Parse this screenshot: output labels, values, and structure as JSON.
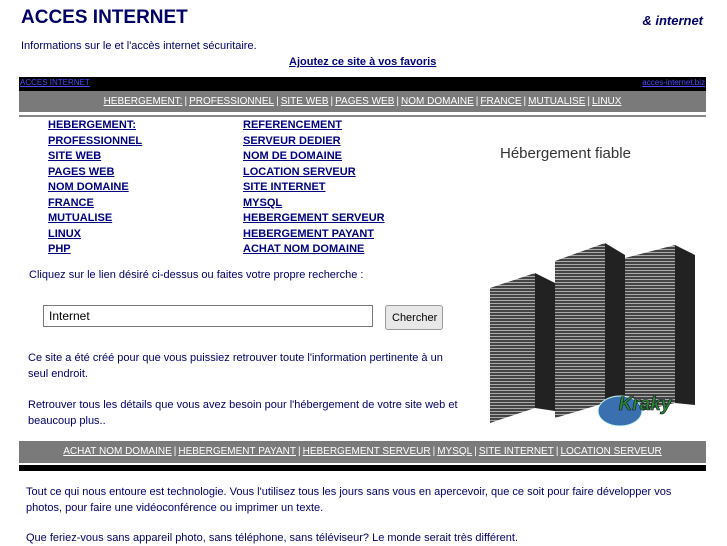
{
  "header": {
    "title": "ACCES INTERNET",
    "tagline": "& internet",
    "intro": "Informations sur le et l'accès internet sécuritaire.",
    "favorites_link": "Ajoutez ce site à vos favoris"
  },
  "blackbar": {
    "left_link": "ACCES INTERNET",
    "right_link": "acces-internet.biz"
  },
  "top_nav": [
    "HEBERGEMENT:",
    "PROFESSIONNEL",
    "SITE WEB",
    "PAGES WEB",
    "NOM DOMAINE",
    "FRANCE",
    "MUTUALISE",
    "LINUX"
  ],
  "links_col1": [
    "HEBERGEMENT:",
    "PROFESSIONNEL",
    "SITE WEB",
    "PAGES WEB",
    "NOM DOMAINE",
    "FRANCE",
    "MUTUALISE",
    "LINUX",
    "PHP"
  ],
  "links_col2": [
    "REFERENCEMENT",
    "SERVEUR DEDIER",
    "NOM DE DOMAINE",
    "LOCATION SERVEUR",
    "SITE INTERNET",
    "MYSQL",
    "HEBERGEMENT SERVEUR",
    "HEBERGEMENT PAYANT",
    "ACHAT NOM DOMAINE"
  ],
  "search": {
    "prompt": "Cliquez sur le lien désiré ci-dessus ou faites votre propre recherche :",
    "value": "Internet",
    "button": "Chercher"
  },
  "ad": {
    "title": "Hébergement fiable",
    "logo_text": "Kraky HOSTING"
  },
  "content": {
    "p1": "Ce site a été créé pour que vous puissiez retrouver toute l'information pertinente à un seul endroit.",
    "p2": "Retrouver tous les détails que vous avez besoin pour l'hébergement de votre site web et beaucoup plus..",
    "p3": "Tout ce qui nous entoure est technologie. Vous l'utilisez tous les jours sans vous en apercevoir, que ce soit pour faire développer vos photos, pour faire une vidéoconférence ou imprimer un texte.",
    "p4": "Que feriez-vous sans appareil photo, sans téléphone, sans téléviseur? Le monde serait très différent."
  },
  "bottom_nav": [
    "ACHAT NOM DOMAINE",
    "HEBERGEMENT PAYANT",
    "HEBERGEMENT SERVEUR",
    "MYSQL",
    "SITE INTERNET",
    "LOCATION SERVEUR"
  ]
}
